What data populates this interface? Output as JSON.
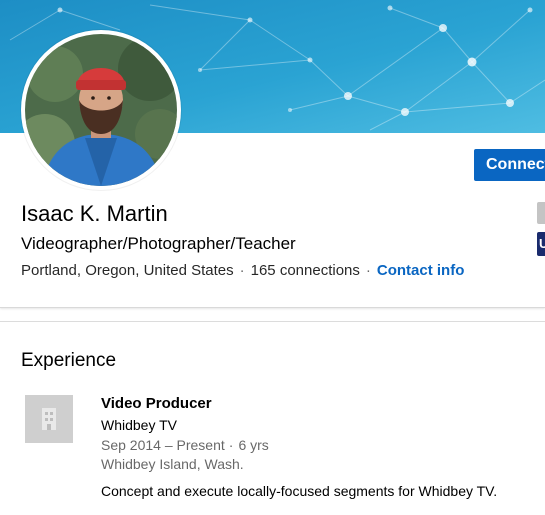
{
  "profile": {
    "name": "Isaac K. Martin",
    "headline": "Videographer/Photographer/Teacher",
    "location": "Portland, Oregon, United States",
    "separator": "·",
    "connections": "165 connections",
    "contact_info": "Contact info",
    "connect_label": "Connect",
    "side_logo_letter": "U"
  },
  "experience": {
    "section_title": "Experience",
    "items": [
      {
        "title": "Video Producer",
        "company": "Whidbey TV",
        "dates": "Sep 2014 – Present",
        "duration": "6 yrs",
        "location": "Whidbey Island, Wash.",
        "description": "Concept and execute locally-focused segments for Whidbey TV."
      }
    ]
  },
  "colors": {
    "accent": "#0a66c2",
    "cover_gradient_start": "#1b8fc4",
    "cover_gradient_end": "#5ac3e6",
    "logo_placeholder": "#cfcfcf",
    "side_logo_bg": "#1a2b6d"
  },
  "icons": {
    "company_logo": "building-icon",
    "cover": "network-nodes-pattern"
  }
}
